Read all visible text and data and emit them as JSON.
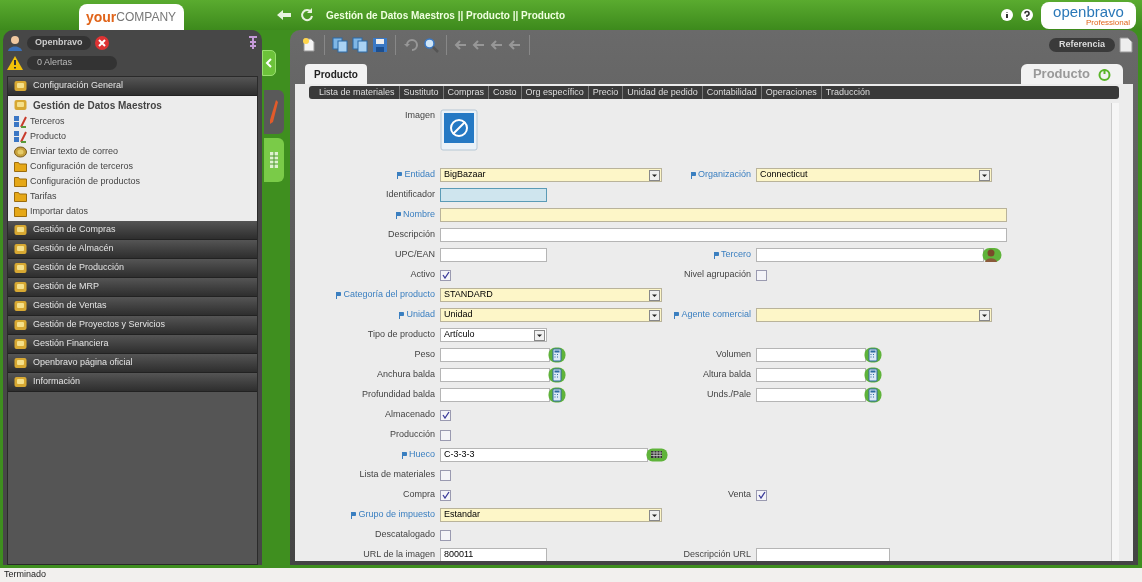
{
  "header": {
    "logo": {
      "strong": "your",
      "light": "COMPANY"
    },
    "breadcrumb": "Gestión de Datos Maestros || Producto || Producto",
    "brand": {
      "name": "openbravo",
      "edition": "Professional"
    }
  },
  "sidebar": {
    "user": "Openbravo",
    "alerts": "0 Alertas",
    "menu": [
      {
        "label": "Configuración General",
        "expanded": false
      },
      {
        "label": "Gestión de Datos Maestros",
        "expanded": true,
        "children": [
          {
            "label": "Terceros",
            "kind": "window"
          },
          {
            "label": "Producto",
            "kind": "window"
          },
          {
            "label": "Enviar texto de correo",
            "kind": "process"
          },
          {
            "label": "Configuración de terceros",
            "kind": "folder"
          },
          {
            "label": "Configuración de productos",
            "kind": "folder"
          },
          {
            "label": "Tarifas",
            "kind": "folder"
          },
          {
            "label": "Importar datos",
            "kind": "folder"
          }
        ]
      },
      {
        "label": "Gestión de Compras",
        "expanded": false
      },
      {
        "label": "Gestión de Almacén",
        "expanded": false
      },
      {
        "label": "Gestión de Producción",
        "expanded": false
      },
      {
        "label": "Gestión de MRP",
        "expanded": false
      },
      {
        "label": "Gestión de Ventas",
        "expanded": false
      },
      {
        "label": "Gestión de Proyectos y Servicios",
        "expanded": false
      },
      {
        "label": "Gestión Financiera",
        "expanded": false
      },
      {
        "label": "Openbravo página oficial",
        "expanded": false
      },
      {
        "label": "Información",
        "expanded": false
      }
    ]
  },
  "view_tabs": [
    {
      "kind": "edit",
      "selected": true
    },
    {
      "kind": "grid",
      "selected": false
    }
  ],
  "toolbar": [
    {
      "kind": "new",
      "disabled": false
    },
    {
      "kind": "copy",
      "disabled": false
    },
    {
      "kind": "copy",
      "disabled": false
    },
    {
      "kind": "save",
      "disabled": false
    },
    {
      "kind": "undo",
      "disabled": true
    },
    {
      "kind": "search",
      "disabled": false
    },
    {
      "kind": "nav",
      "disabled": true
    },
    {
      "kind": "nav",
      "disabled": true
    },
    {
      "kind": "nav",
      "disabled": true
    },
    {
      "kind": "nav",
      "disabled": true
    }
  ],
  "reference_button": "Referencia",
  "tabs": [
    {
      "label": "Producto",
      "selected": true
    }
  ],
  "window_name": "Producto",
  "subtabs": [
    "Lista de materiales",
    "Sustituto",
    "Compras",
    "Costo",
    "Org específico",
    "Precio",
    "Unidad de pedido",
    "Contabilidad",
    "Operaciones",
    "Traducción"
  ],
  "form": [
    {
      "left": {
        "label": "Imagen",
        "kind": "image",
        "required": false
      }
    },
    {
      "left": {
        "label": "Entidad",
        "kind": "select",
        "value": "BigBazaar",
        "required": true
      },
      "right": {
        "label": "Organización",
        "kind": "select",
        "value": "Connecticut",
        "required": true
      }
    },
    {
      "left": {
        "label": "Identificador",
        "kind": "text",
        "required": false,
        "focused": true
      }
    },
    {
      "full": {
        "label": "Nombre",
        "kind": "text",
        "required": true,
        "focused": false
      }
    },
    {
      "full": {
        "label": "Descripción",
        "kind": "text",
        "required": false,
        "focused": false
      }
    },
    {
      "left": {
        "label": "UPC/EAN",
        "kind": "text",
        "required": false,
        "focused": false
      },
      "right": {
        "label": "Tercero",
        "kind": "search",
        "required": true
      }
    },
    {
      "left": {
        "label": "Activo",
        "kind": "checkbox",
        "checked": true,
        "required": false
      },
      "right": {
        "label": "Nivel agrupación",
        "kind": "checkbox",
        "checked": false,
        "required": false
      }
    },
    {
      "left": {
        "label": "Categoría del producto",
        "kind": "select",
        "value": "STANDARD",
        "required": true
      }
    },
    {
      "left": {
        "label": "Unidad",
        "kind": "select",
        "value": "Unidad",
        "required": true
      },
      "right": {
        "label": "Agente comercial",
        "kind": "select",
        "required": true
      }
    },
    {
      "left": {
        "label": "Tipo de producto",
        "kind": "list",
        "value": "Artículo",
        "required": false
      }
    },
    {
      "left": {
        "label": "Peso",
        "kind": "number",
        "required": false
      },
      "right": {
        "label": "Volumen",
        "kind": "number",
        "required": false
      }
    },
    {
      "left": {
        "label": "Anchura balda",
        "kind": "number",
        "required": false
      },
      "right": {
        "label": "Altura balda",
        "kind": "number",
        "required": false
      }
    },
    {
      "left": {
        "label": "Profundidad balda",
        "kind": "number",
        "required": false
      },
      "right": {
        "label": "Unds./Pale",
        "kind": "number",
        "required": false
      }
    },
    {
      "left": {
        "label": "Almacenado",
        "kind": "checkbox",
        "checked": true,
        "required": false
      }
    },
    {
      "left": {
        "label": "Producción",
        "kind": "checkbox",
        "checked": false,
        "required": false
      }
    },
    {
      "left": {
        "label": "Hueco",
        "kind": "locator",
        "value": "C-3-3-3",
        "required": true
      }
    },
    {
      "left": {
        "label": "Lista de materiales",
        "kind": "checkbox",
        "checked": false,
        "required": false
      }
    },
    {
      "left": {
        "label": "Compra",
        "kind": "checkbox",
        "checked": true,
        "required": false
      },
      "right": {
        "label": "Venta",
        "kind": "checkbox",
        "checked": true,
        "required": false
      }
    },
    {
      "left": {
        "label": "Grupo de impuesto",
        "kind": "select",
        "value": "Estandar",
        "required": true
      }
    },
    {
      "left": {
        "label": "Descatalogado",
        "kind": "checkbox",
        "checked": false,
        "required": false
      }
    },
    {
      "left": {
        "label": "URL de la imagen",
        "kind": "text",
        "value": "800011",
        "required": false,
        "focused": false
      },
      "right": {
        "label": "Descripción URL",
        "kind": "text",
        "required": false,
        "focused": false
      }
    }
  ],
  "status_bar": "Terminado"
}
